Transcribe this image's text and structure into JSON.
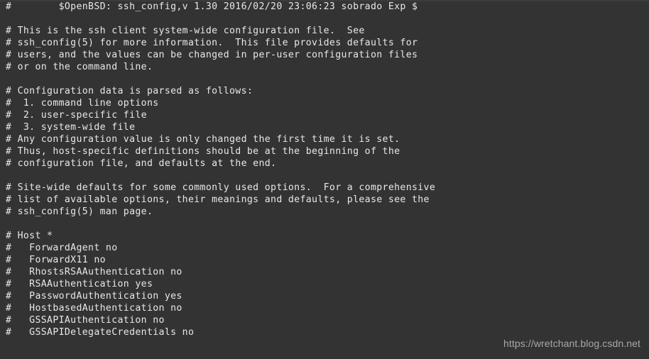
{
  "terminal": {
    "background_color": "#333333",
    "text_color": "#e8e8e8",
    "watermark_color": "#a8a8a8",
    "watermark": "https://wretchant.blog.csdn.net"
  },
  "file": {
    "lines": [
      "#\t$OpenBSD: ssh_config,v 1.30 2016/02/20 23:06:23 sobrado Exp $",
      "",
      "# This is the ssh client system-wide configuration file.  See",
      "# ssh_config(5) for more information.  This file provides defaults for",
      "# users, and the values can be changed in per-user configuration files",
      "# or on the command line.",
      "",
      "# Configuration data is parsed as follows:",
      "#  1. command line options",
      "#  2. user-specific file",
      "#  3. system-wide file",
      "# Any configuration value is only changed the first time it is set.",
      "# Thus, host-specific definitions should be at the beginning of the",
      "# configuration file, and defaults at the end.",
      "",
      "# Site-wide defaults for some commonly used options.  For a comprehensive",
      "# list of available options, their meanings and defaults, please see the",
      "# ssh_config(5) man page.",
      "",
      "# Host *",
      "#   ForwardAgent no",
      "#   ForwardX11 no",
      "#   RhostsRSAAuthentication no",
      "#   RSAAuthentication yes",
      "#   PasswordAuthentication yes",
      "#   HostbasedAuthentication no",
      "#   GSSAPIAuthentication no",
      "#   GSSAPIDelegateCredentials no"
    ]
  }
}
